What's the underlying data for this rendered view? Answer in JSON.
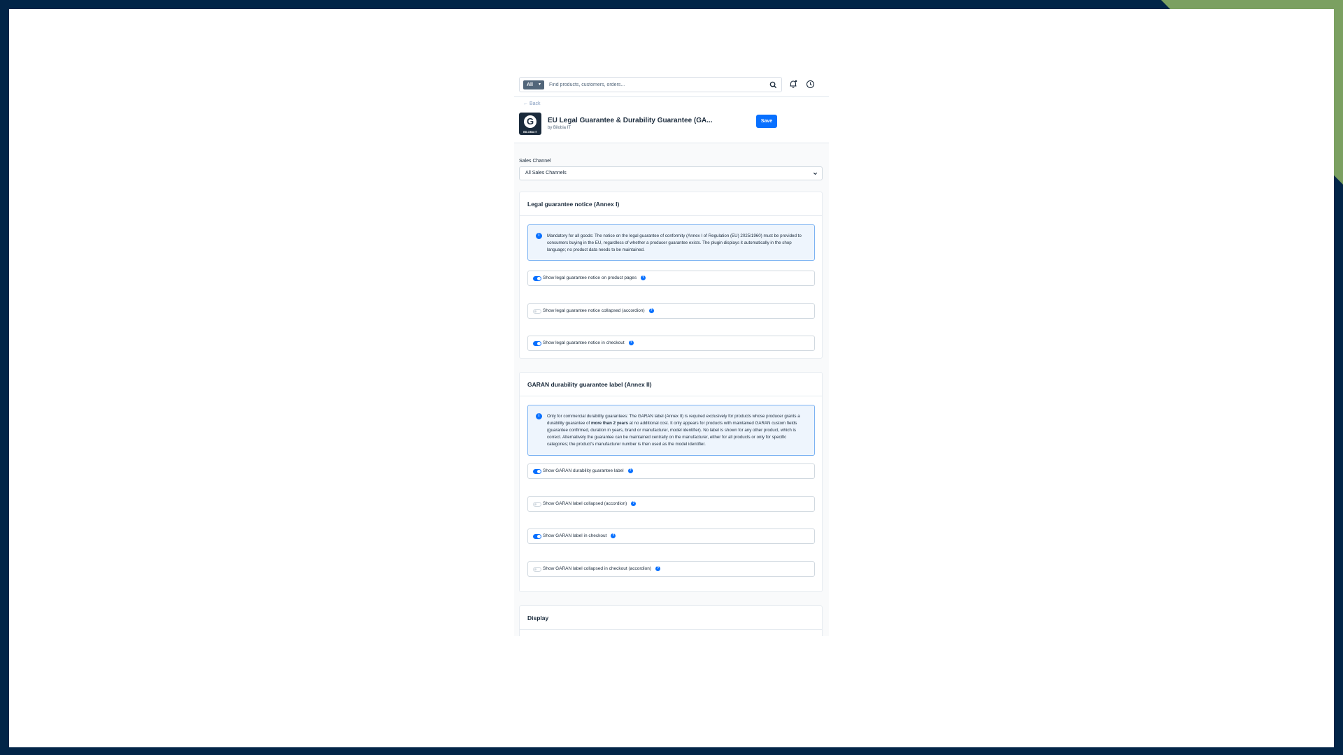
{
  "search": {
    "scope_label": "All",
    "placeholder": "Find products, customers, orders..."
  },
  "header": {
    "back_label": "← Back",
    "title": "EU Legal Guarantee & Durability Guarantee (GA...",
    "vendor": "by Bilobia IT",
    "logo_text": "BILOBA IT",
    "logo_letter": "G",
    "save_label": "Save"
  },
  "sales_channel": {
    "label": "Sales Channel",
    "selected": "All Sales Channels"
  },
  "legal_section": {
    "title": "Legal guarantee notice (Annex I)",
    "info": "Mandatory for all goods: The notice on the legal guarantee of conformity (Annex I of Regulation (EU) 2025/1960) must be provided to consumers buying in the EU, regardless of whether a producer guarantee exists. The plugin displays it automatically in the shop language; no product data needs to be maintained.",
    "toggles": [
      {
        "label": "Show legal guarantee notice on product pages",
        "on": true
      },
      {
        "label": "Show legal guarantee notice collapsed (accordion)",
        "on": false
      },
      {
        "label": "Show legal guarantee notice in checkout",
        "on": true
      }
    ]
  },
  "garan_section": {
    "title": "GARAN durability guarantee label (Annex II)",
    "info_before": "Only for commercial durability guarantees: The GARAN label (Annex II) is required exclusively for products whose producer grants a durability guarantee of ",
    "info_bold": "more than 2 years",
    "info_after": " at no additional cost. It only appears for products with maintained GARAN custom fields (guarantee confirmed, duration in years, brand or manufacturer, model identifier). No label is shown for any other product, which is correct. Alternatively the guarantee can be maintained centrally on the manufacturer, either for all products or only for specific categories; the product's manufacturer number is then used as the model identifier.",
    "toggles": [
      {
        "label": "Show GARAN durability guarantee label",
        "on": true
      },
      {
        "label": "Show GARAN label collapsed (accordion)",
        "on": false
      },
      {
        "label": "Show GARAN label in checkout",
        "on": true
      },
      {
        "label": "Show GARAN label collapsed in checkout (accordion)",
        "on": false
      }
    ]
  },
  "display_section": {
    "title": "Display"
  },
  "help_glyph": "?",
  "info_glyph": "i",
  "colors": {
    "accent": "#0870ff",
    "background": "#022548",
    "corner": "#7ba061"
  }
}
